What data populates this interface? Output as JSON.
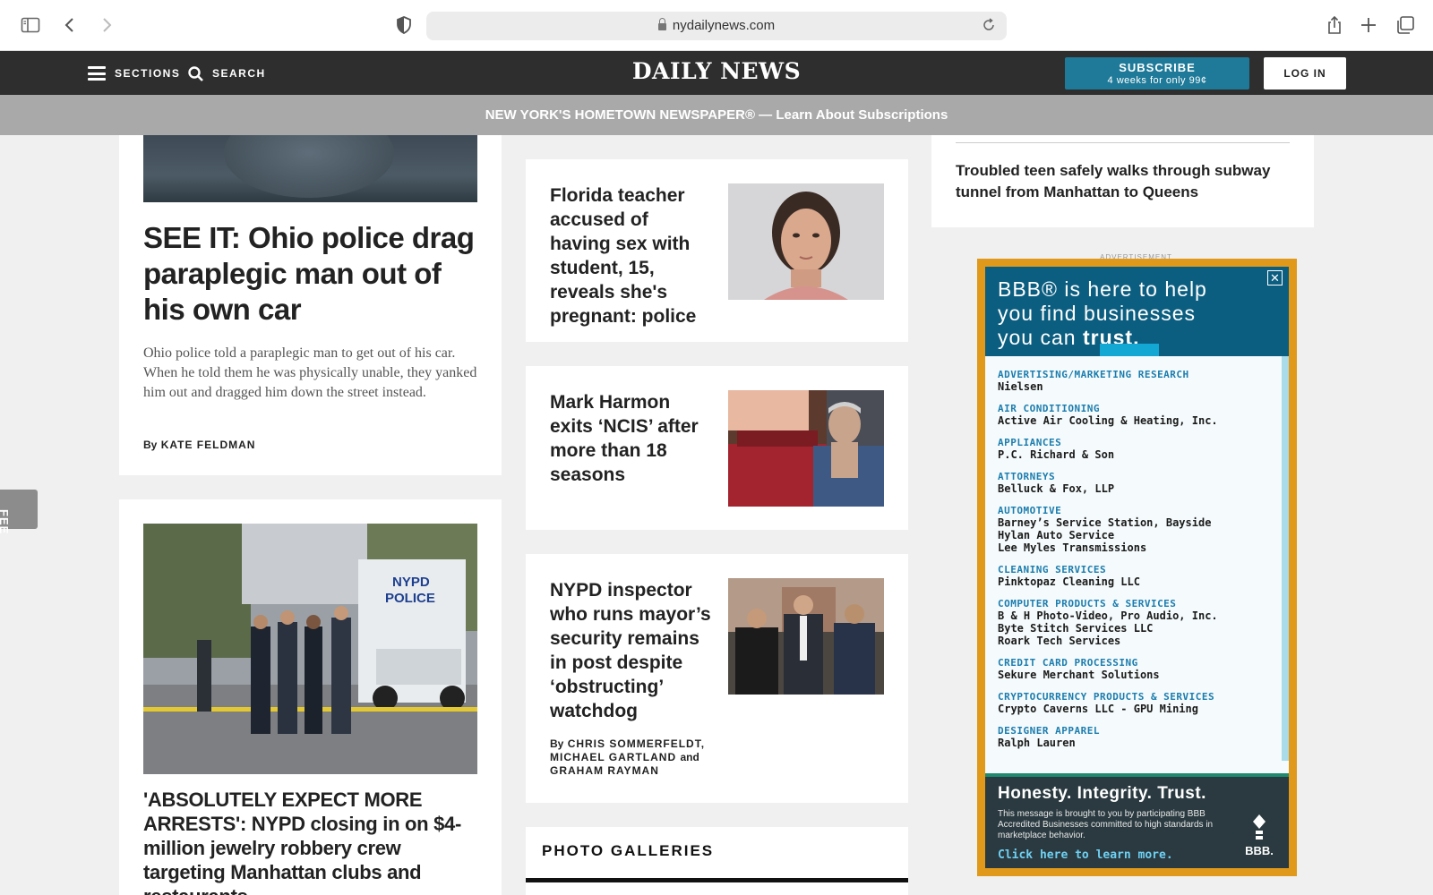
{
  "browser": {
    "url": "nydailynews.com"
  },
  "header": {
    "sections_label": "SECTIONS",
    "search_label": "SEARCH",
    "logo_text": "DAILY NEWS",
    "subscribe_title": "SUBSCRIBE",
    "subscribe_subtitle": "4 weeks for only 99¢",
    "login_label": "LOG IN"
  },
  "promo_bar": {
    "text": "NEW YORK'S HOMETOWN NEWSPAPER® — Learn About Subscriptions"
  },
  "left_column": {
    "story1": {
      "headline": "SEE IT: Ohio police drag paraplegic man out of his own car",
      "summary": "Ohio police told a paraplegic man to get out of his car. When he told them he was physically unable, they yanked him out and dragged him down the street instead.",
      "byline_prefix": "By",
      "byline_author": "KATE FELDMAN"
    },
    "story2": {
      "headline": "'ABSOLUTELY EXPECT MORE ARRESTS': NYPD closing in on $4-million jewelry robbery crew targeting Manhattan clubs and restaurants"
    }
  },
  "feedback_tab": {
    "label": "FEE"
  },
  "middle_column": {
    "stories": [
      {
        "headline": "Florida teacher accused of having sex with student, 15, reveals she's pregnant: police"
      },
      {
        "headline": "Mark Harmon exits ‘NCIS’ after more than 18 seasons"
      },
      {
        "headline": "NYPD inspector who runs mayor’s security remains in post despite ‘obstructing’ watchdog",
        "byline_prefix": "By",
        "byline_line1": "CHRIS SOMMERFELDT,",
        "byline_line2": "MICHAEL GARTLAND",
        "byline_and": "and",
        "byline_line3": "GRAHAM RAYMAN"
      }
    ],
    "photo_galleries_label": "PHOTO GALLERIES"
  },
  "right_column": {
    "top_story": {
      "headline": "Troubled teen safely walks through subway tunnel from Manhattan to Queens"
    },
    "ad": {
      "label": "ADVERTISEMENT",
      "message_line1": "BBB® is here to help",
      "message_line2": "you find businesses",
      "message_line3_pre": "you can",
      "message_line3_strong": "trust.",
      "close_glyph": "✕",
      "categories": [
        {
          "category": "ADVERTISING/MARKETING RESEARCH",
          "businesses": [
            "Nielsen"
          ]
        },
        {
          "category": "AIR CONDITIONING",
          "businesses": [
            "Active Air Cooling & Heating, Inc."
          ]
        },
        {
          "category": "APPLIANCES",
          "businesses": [
            "P.C. Richard & Son"
          ]
        },
        {
          "category": "ATTORNEYS",
          "businesses": [
            "Belluck & Fox, LLP"
          ]
        },
        {
          "category": "AUTOMOTIVE",
          "businesses": [
            "Barney’s Service Station, Bayside",
            "Hylan Auto Service",
            "Lee Myles Transmissions"
          ]
        },
        {
          "category": "CLEANING SERVICES",
          "businesses": [
            "Pinktopaz Cleaning LLC"
          ]
        },
        {
          "category": "COMPUTER PRODUCTS & SERVICES",
          "businesses": [
            "B & H Photo-Video, Pro Audio, Inc.",
            "Byte Stitch Services LLC",
            "Roark Tech Services"
          ]
        },
        {
          "category": "CREDIT CARD PROCESSING",
          "businesses": [
            "Sekure Merchant Solutions"
          ]
        },
        {
          "category": "CRYPTOCURRENCY PRODUCTS & SERVICES",
          "businesses": [
            "Crypto Caverns LLC - GPU Mining"
          ]
        },
        {
          "category": "DESIGNER APPAREL",
          "businesses": [
            "Ralph Lauren"
          ]
        }
      ],
      "bottom_headline": "Honesty. Integrity. Trust.",
      "bottom_body": "This message is brought to you by participating BBB Accredited Businesses committed to high standards in marketplace behavior.",
      "cta": "Click here to learn more.",
      "bbb_logo_text": "BBB."
    }
  },
  "colors": {
    "header_bg": "#2e2e2e",
    "subscribe_bg": "#1e7a98",
    "promo_bg": "#a9a9a9",
    "ad_frame": "#e0991a",
    "ad_blue": "#0c5e80"
  }
}
